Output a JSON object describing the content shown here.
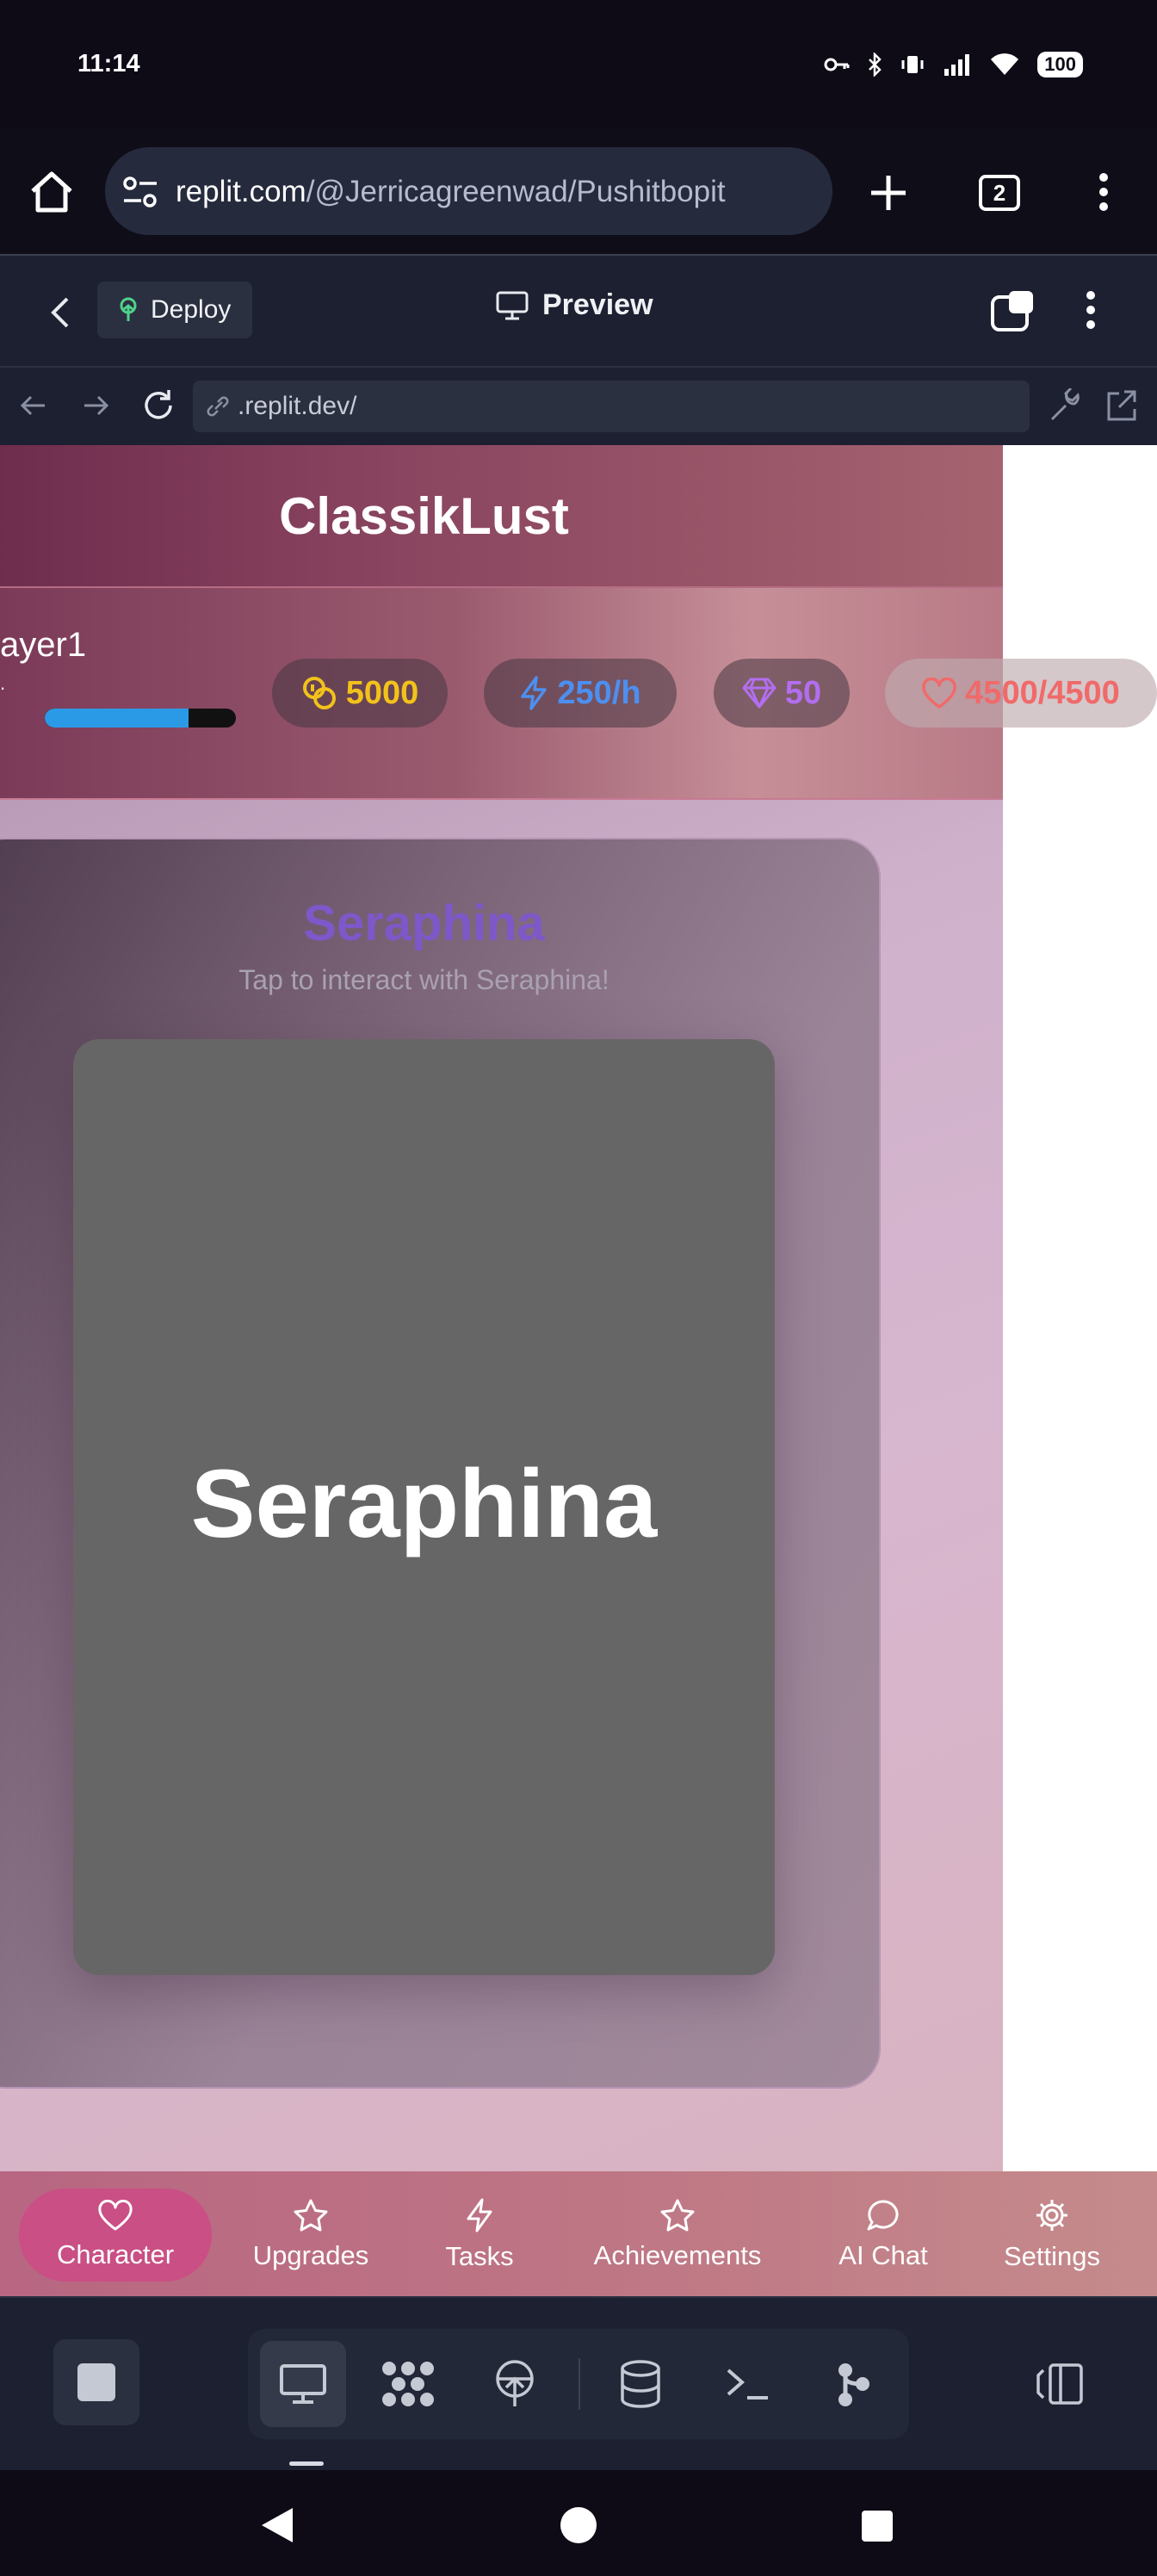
{
  "status_bar": {
    "time": "11:14",
    "battery": "100"
  },
  "browser": {
    "url_host": "replit.com",
    "url_path": "/@Jerricagreenwad/Pushitbopit",
    "tabs_count": "2"
  },
  "replit": {
    "deploy_label": "Deploy",
    "preview_label": "Preview",
    "preview_url": ".replit.dev/"
  },
  "app": {
    "title": "ClassikLust",
    "player": {
      "name": "ayer1",
      "level_text": ".",
      "xp_fraction": 0.75
    },
    "stats": {
      "coins": "5000",
      "energy_rate": "250/h",
      "gems": "50",
      "health": "4500/4500"
    },
    "character": {
      "name": "Seraphina",
      "subtitle": "Tap to interact with Seraphina!",
      "card_label": "Seraphina"
    },
    "nav": [
      {
        "label": "Character",
        "icon": "heart-icon"
      },
      {
        "label": "Upgrades",
        "icon": "star-icon"
      },
      {
        "label": "Tasks",
        "icon": "lightning-icon"
      },
      {
        "label": "Achievements",
        "icon": "star-icon"
      },
      {
        "label": "AI Chat",
        "icon": "chat-bubble-icon"
      },
      {
        "label": "Settings",
        "icon": "gear-icon"
      }
    ]
  },
  "colors": {
    "coins": "#f2c21b",
    "energy": "#4d8ff0",
    "gems": "#b36ef0",
    "health": "#f06a6a",
    "accent_nav": "#c94f84",
    "character_name": "#7d58c8"
  }
}
